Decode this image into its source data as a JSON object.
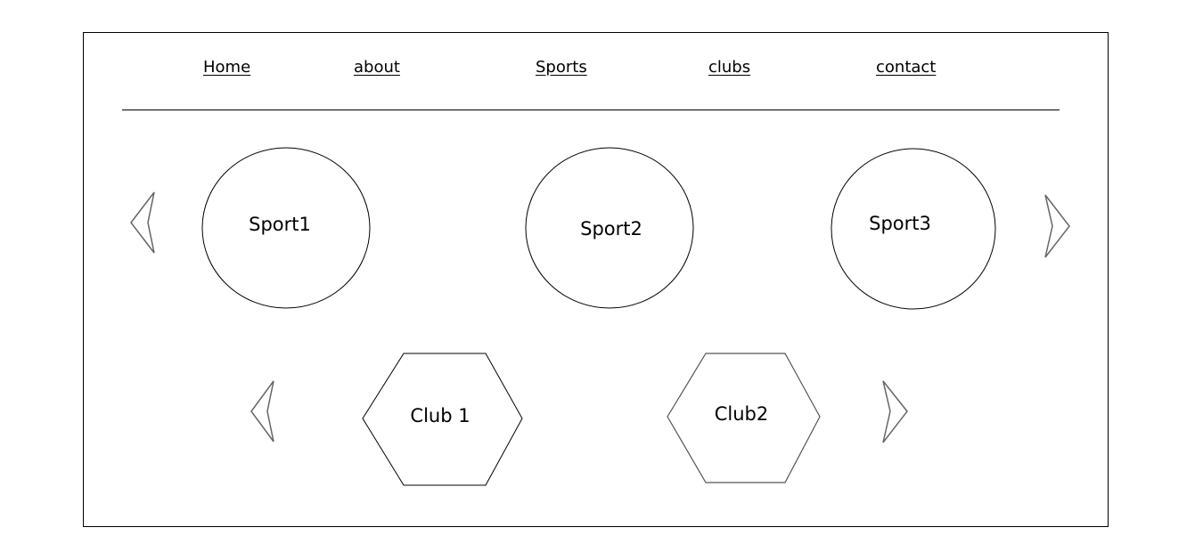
{
  "nav": {
    "items": [
      {
        "label": "Home"
      },
      {
        "label": "about"
      },
      {
        "label": "Sports"
      },
      {
        "label": "clubs"
      },
      {
        "label": "contact"
      }
    ]
  },
  "sports": {
    "items": [
      {
        "label": "Sport1"
      },
      {
        "label": "Sport2"
      },
      {
        "label": "Sport3"
      }
    ],
    "prev_icon": "chevron-left-icon",
    "next_icon": "chevron-right-icon"
  },
  "clubs": {
    "items": [
      {
        "label": "Club 1"
      },
      {
        "label": "Club2"
      }
    ],
    "prev_icon": "chevron-left-icon",
    "next_icon": "chevron-right-icon"
  },
  "colors": {
    "stroke": "#000000",
    "arrow_stroke": "#666666",
    "background": "#ffffff"
  }
}
